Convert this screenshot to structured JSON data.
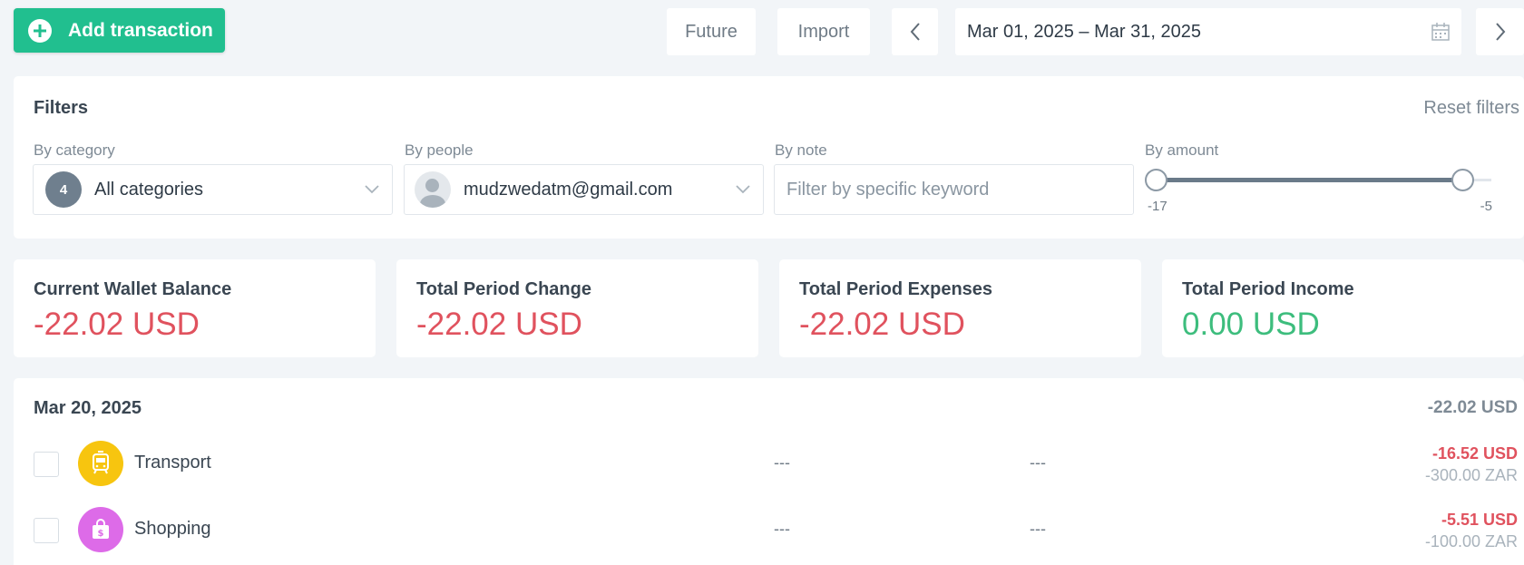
{
  "toolbar": {
    "add_label": "Add transaction",
    "future_label": "Future",
    "import_label": "Import",
    "date_range": "Mar 01, 2025 – Mar 31, 2025"
  },
  "filters": {
    "title": "Filters",
    "reset_label": "Reset filters",
    "category": {
      "label": "By category",
      "count": "4",
      "value": "All categories"
    },
    "people": {
      "label": "By people",
      "value": "mudzwedatm@gmail.com"
    },
    "note": {
      "label": "By note",
      "placeholder": "Filter by specific keyword"
    },
    "amount": {
      "label": "By amount",
      "min": "-17",
      "max": "-5"
    }
  },
  "summary": [
    {
      "title": "Current Wallet Balance",
      "value": "-22.02 USD"
    },
    {
      "title": "Total Period Change",
      "value": "-22.02 USD"
    },
    {
      "title": "Total Period Expenses",
      "value": "-22.02 USD"
    },
    {
      "title": "Total Period Income",
      "value": "0.00 USD"
    }
  ],
  "transactions": {
    "date": "Mar 20, 2025",
    "total": "-22.02 USD",
    "items": [
      {
        "category": "Transport",
        "note": "---",
        "people": "---",
        "amount": "-16.52 USD",
        "original": "-300.00 ZAR",
        "color": "#f7c50f",
        "icon": "tram-icon"
      },
      {
        "category": "Shopping",
        "note": "---",
        "people": "---",
        "amount": "-5.51 USD",
        "original": "-100.00 ZAR",
        "color": "#dd6be8",
        "icon": "shopping-bag-icon"
      }
    ]
  },
  "colors": {
    "accent": "#21bf8f",
    "negative": "#e0525e",
    "positive": "#3dbd7d"
  }
}
